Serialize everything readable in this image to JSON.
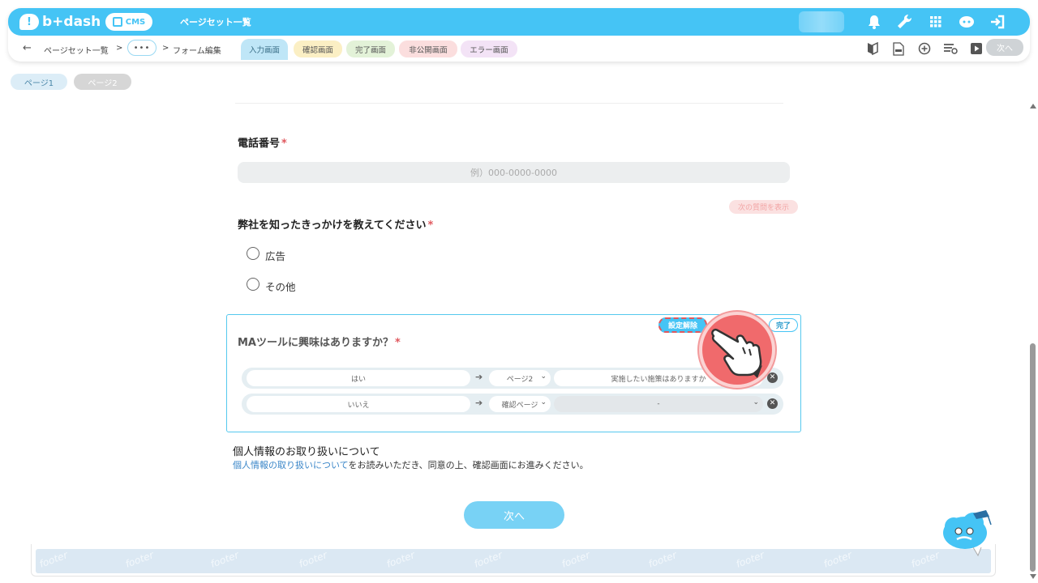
{
  "header": {
    "logo_text": "b+dash",
    "cms_label": "CMS",
    "title": "ページセット一覧"
  },
  "breadcrumb": {
    "item1": "ページセット一覧",
    "sep": ">",
    "dots": "•••",
    "item3": "フォーム編集"
  },
  "tabs": [
    {
      "label": "入力画面",
      "color": "#bfe6f7"
    },
    {
      "label": "確認画面",
      "color": "#fbefc4"
    },
    {
      "label": "完了画面",
      "color": "#e3f2d8"
    },
    {
      "label": "非公開画面",
      "color": "#fbdede"
    },
    {
      "label": "エラー画面",
      "color": "#f3e3f6"
    }
  ],
  "toolbar": {
    "next_label": "次へ"
  },
  "pages": [
    {
      "label": "ページ1"
    },
    {
      "label": "ページ2"
    }
  ],
  "form": {
    "phone": {
      "label": "電話番号",
      "required": "*",
      "placeholder": "例）000-0000-0000"
    },
    "next_question_label": "次の質問を表示",
    "source": {
      "label": "弊社を知ったきっかけを教えてください",
      "required": "*",
      "options": [
        "広告",
        "その他"
      ]
    },
    "ma": {
      "label": "MAツールに興味はありますか？",
      "required": "*",
      "unset_label": "設定解除",
      "done_label": "完了",
      "branches": [
        {
          "answer": "はい",
          "page": "ページ2",
          "question": "実施したい施策はありますか"
        },
        {
          "answer": "いいえ",
          "page": "確認ページ",
          "question": "-"
        }
      ]
    },
    "privacy": {
      "title": "個人情報のお取り扱いについて",
      "link_text": "個人情報の取り扱いについて",
      "rest_text": "をお読みいただき、同意の上、確認画面にお進みください。"
    },
    "next_label": "次へ"
  },
  "footer": {
    "word": "footer"
  },
  "colors": {
    "accent": "#45c4f5",
    "required": "#e0585e",
    "footer_bg": "#dbe8f3"
  }
}
